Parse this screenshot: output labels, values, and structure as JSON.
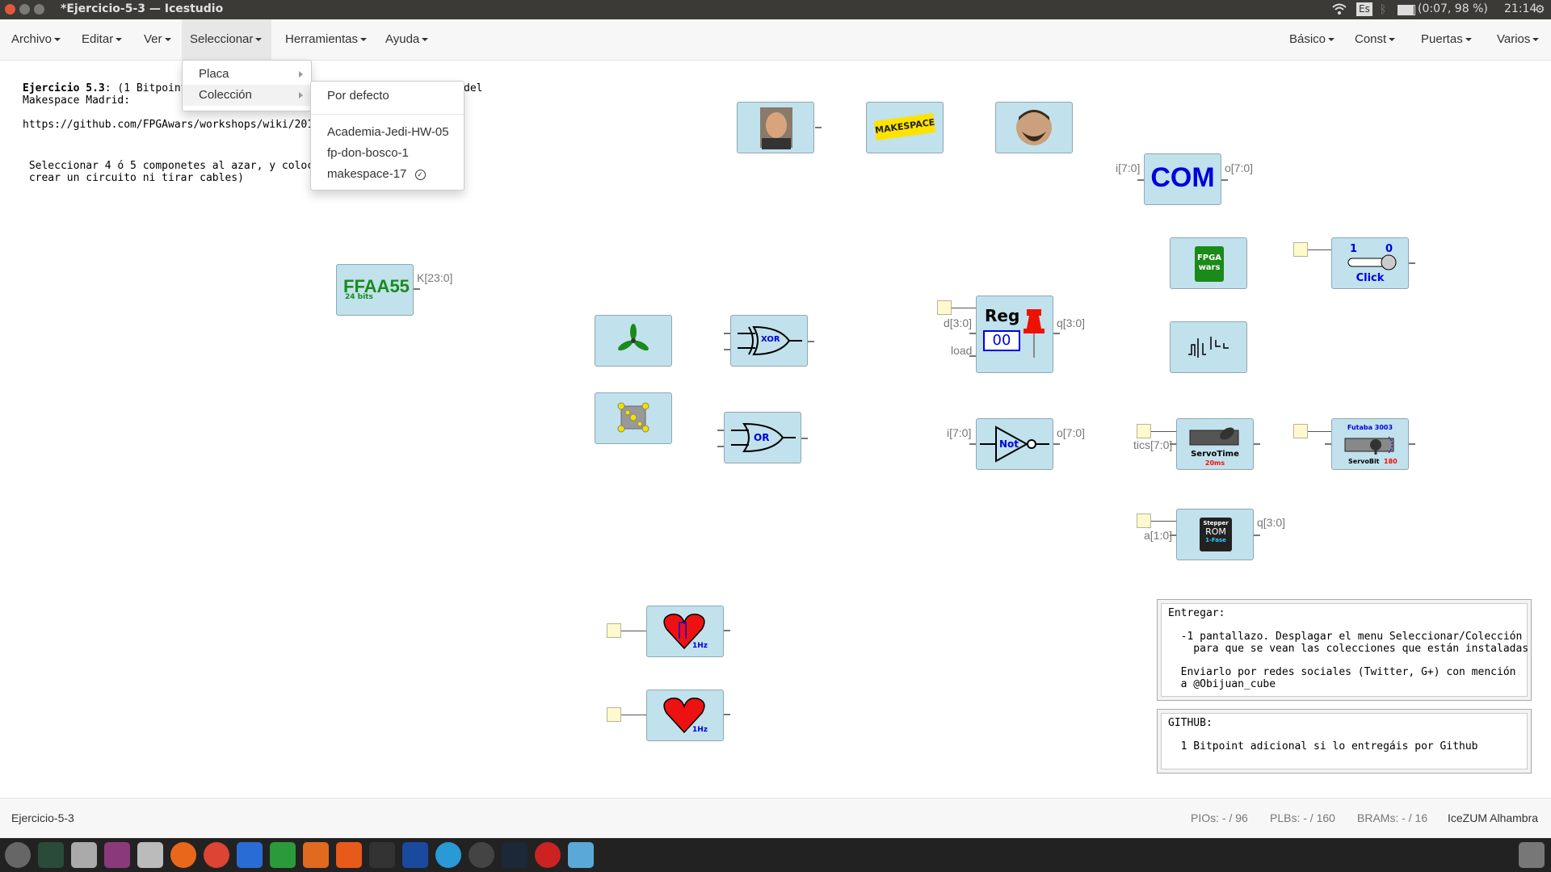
{
  "window": {
    "title": "*Ejercicio-5-3 — Icestudio",
    "keyboard_layout": "Es",
    "battery": "(0:07, 98 %)",
    "clock": "21:14"
  },
  "menubar": {
    "left": [
      "Archivo",
      "Editar",
      "Ver",
      "Seleccionar",
      "Herramientas",
      "Ayuda"
    ],
    "right": [
      "Básico",
      "Const",
      "Puertas",
      "Varios"
    ]
  },
  "select_menu": {
    "items": [
      "Placa",
      "Colección"
    ],
    "collection_submenu": {
      "default": "Por defecto",
      "items": [
        "Academia-Jedi-HW-05",
        "fp-don-bosco-1",
        "makespace-17"
      ],
      "selected": "makespace-17"
    }
  },
  "canvas": {
    "exercise_title_bold": "Ejercicio 5.3",
    "exercise_line1_rest": ": (1 Bitpoint",
    "exercise_line1_tail": "del",
    "exercise_line2": "Makespace Madrid:",
    "exercise_url": "https://github.com/FPGAwars/workshops/wiki/2017_",
    "instructions_line1": " Seleccionar 4 ó 5 componetes al azar, y colocar",
    "instructions_line2": " crear un circuito ni tirar cables)",
    "blocks": {
      "makespace_logo": "MAKESPACE",
      "com": "COM",
      "com_in": "i[7:0]",
      "com_out": "o[7:0]",
      "ffaa55": "FFAA55",
      "ffaa55_sub": "24 bits",
      "ffaa55_out": "K[23:0]",
      "fpgawars_logo": [
        "FPGA",
        "wars"
      ],
      "click_1": "1",
      "click_0": "0",
      "click_label": "Click",
      "xor_label": "XOR",
      "or_label": "OR",
      "reg_title": "Reg",
      "reg_value": "00",
      "reg_d": "d[3:0]",
      "reg_load": "load",
      "reg_q": "q[3:0]",
      "not_label": "Not",
      "not_in": "i[7:0]",
      "not_out": "o[7:0]",
      "servotime_label": "ServoTime",
      "servotime_sub": "20ms",
      "servotime_in": "tics[7:0]",
      "futaba_title": "Futaba 3003",
      "servobit_label": "ServoBit",
      "servobit_value": "180",
      "stepper_title": "Stepper",
      "stepper_rom": "ROM",
      "stepper_mode": "1-Fase",
      "stepper_in": "a[1:0]",
      "stepper_out": "q[3:0]",
      "heart_freq": "1Hz"
    },
    "entregar": {
      "title": "Entregar:",
      "line1": "  -1 pantallazo. Desplagar el menu Seleccionar/Colección",
      "line2": "    para que se vean las colecciones que están instaladas",
      "line3": "  Enviarlo por redes sociales (Twitter, G+) con mención",
      "line4": "  a @Obijuan_cube"
    },
    "github": {
      "title": "GITHUB:",
      "line1": "  1 Bitpoint adicional si lo entregáis por Github"
    }
  },
  "statusbar": {
    "project": "Ejercicio-5-3",
    "pios": "PIOs:  - / 96",
    "plbs": "PLBs:  - / 160",
    "brams": "BRAMs:  - / 16",
    "board": "IceZUM Alhambra"
  },
  "colors": {
    "block_bg": "#c1e1ec",
    "input_box": "#fffacd",
    "com_text": "#0000dd",
    "ffaa55_text": "#1a8a1a",
    "heart": "#ee1111"
  }
}
